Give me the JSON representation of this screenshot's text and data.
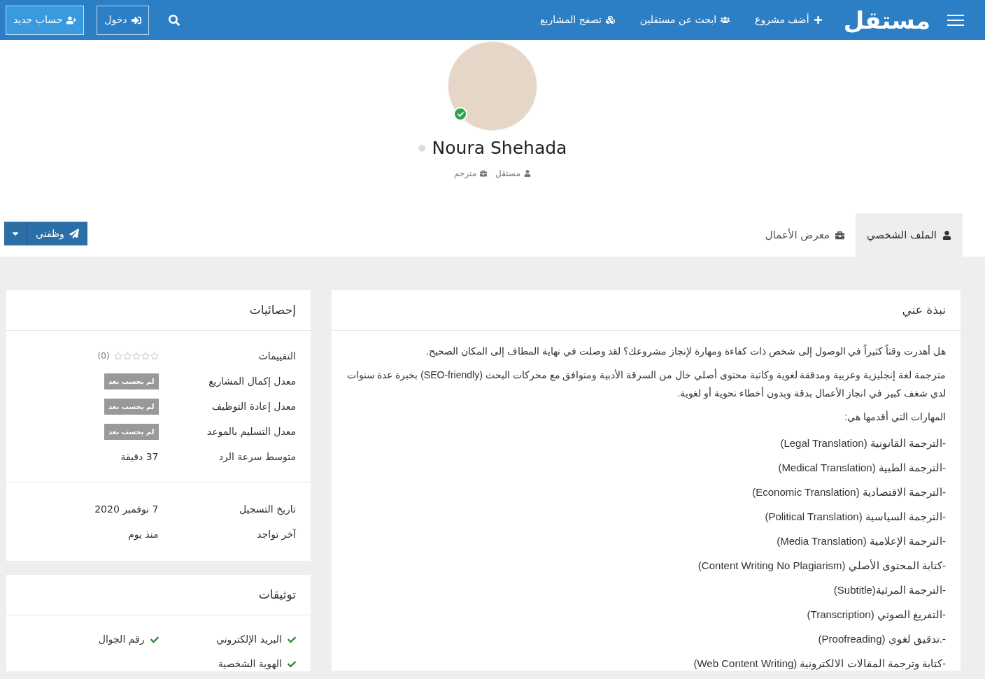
{
  "header": {
    "logo": "مستقل",
    "nav": [
      {
        "label": "أضف مشروع",
        "kind": "add"
      },
      {
        "label": "ابحث عن مستقلين",
        "kind": "people"
      },
      {
        "label": "تصفح المشاريع",
        "kind": "projects"
      }
    ],
    "login": "دخول",
    "signup": "حساب جديد"
  },
  "profile": {
    "name": "Noura Shehada",
    "online": false,
    "verified": true,
    "meta": [
      {
        "label": "مستقل",
        "kind": "person"
      },
      {
        "label": "مترجم",
        "kind": "work"
      }
    ]
  },
  "tabs": [
    {
      "label": "الملف الشخصي",
      "kind": "person",
      "selected": true
    },
    {
      "label": "معرض الأعمال",
      "kind": "work",
      "selected": false
    }
  ],
  "hire_button": "وظفني",
  "about": {
    "title": "نبذة عني",
    "paragraphs": [
      "هل أهدرت وقتاً كثيراً في الوصول إلى شخص ذات كفاءة ومهارة لإنجاز مشروعك؟ لقد وصلت في نهاية المطاف إلى المكان الصحيح.",
      "مترجمة لغة إنجليزية وعربية ومدققة لغوية وكاتبة محتوى أصلي خال من السرقة الأدبية ومتوافق مع محركات البحث (SEO-friendly) بخبرة عدة سنوات لدي شغف كبير في انجاز الأعمال بدقة وبدون أخطاء نحوية أو لغوية.",
      "المهارات التي أقدمها هي:"
    ],
    "skills": [
      "-الترجمة القانونية (Legal Translation)",
      "-الترجمة الطبية (Medical Translation)",
      "-الترجمة الاقتصادية (Economic Translation)",
      "-الترجمة السياسية (Political Translation)",
      "-الترجمة الإعلامية (Media Translation)",
      "-كتابة المحتوى الأصلي (Content Writing No Plagiarism)",
      "-الترجمة المرئية(Subtitle)",
      "-التفريغ الصوتي (Transcription)",
      "-.تدقيق لغوي (Proofreading)",
      "-كتابة وترجمة المقالات الالكترونية (Web Content Writing)"
    ]
  },
  "stats": {
    "title": "إحصائيات",
    "rows": [
      {
        "kind": "stars",
        "label": "التقييمات",
        "stars": 0,
        "count": "(0)"
      },
      {
        "kind": "badge",
        "label": "معدل إكمال المشاريع",
        "value": "لم يحسب بعد"
      },
      {
        "kind": "badge",
        "label": "معدل إعادة التوظيف",
        "value": "لم يحسب بعد"
      },
      {
        "kind": "badge",
        "label": "معدل التسليم بالموعد",
        "value": "لم يحسب بعد"
      },
      {
        "kind": "text",
        "label": "متوسط سرعة الرد",
        "value": "37 دقيقة"
      }
    ],
    "dates": [
      {
        "label": "تاريخ التسجيل",
        "value": "7 نوفمبر 2020"
      },
      {
        "label": "آخر تواجد",
        "value": "منذ يوم"
      }
    ]
  },
  "verifications": {
    "title": "توثيقات",
    "items": [
      {
        "label": "البريد الإلكتروني",
        "checked": true
      },
      {
        "label": "رقم الجوال",
        "checked": true
      },
      {
        "label": "الهوية الشخصية",
        "checked": true
      }
    ]
  }
}
